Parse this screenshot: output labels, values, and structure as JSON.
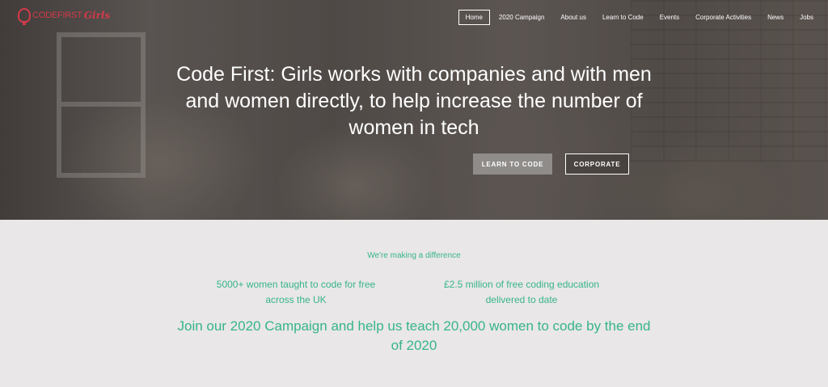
{
  "logo": {
    "text": "CODEFIRST",
    "text2": "Girls"
  },
  "nav": {
    "items": [
      {
        "label": "Home"
      },
      {
        "label": "2020 Campaign"
      },
      {
        "label": "About us"
      },
      {
        "label": "Learn to Code"
      },
      {
        "label": "Events"
      },
      {
        "label": "Corporate Activities"
      },
      {
        "label": "News"
      },
      {
        "label": "Jobs"
      }
    ],
    "active": "Home"
  },
  "hero": {
    "headline": "Code First: Girls works with companies and with men and women directly, to help increase the number of women in tech",
    "learn_button": "LEARN TO CODE",
    "corporate_button": "CORPORATE"
  },
  "impact": {
    "heading": "We're making a difference",
    "stat_1": "5000+ women taught to code for free across the UK",
    "stat_2": "£2.5 million of free coding education delivered to date",
    "campaign": "Join our 2020 Campaign and help us teach 20,000 women to code by the end of 2020"
  },
  "colors": {
    "accent": "#37b48b",
    "brand": "#d33a4a",
    "background": "#e9e7e7"
  }
}
